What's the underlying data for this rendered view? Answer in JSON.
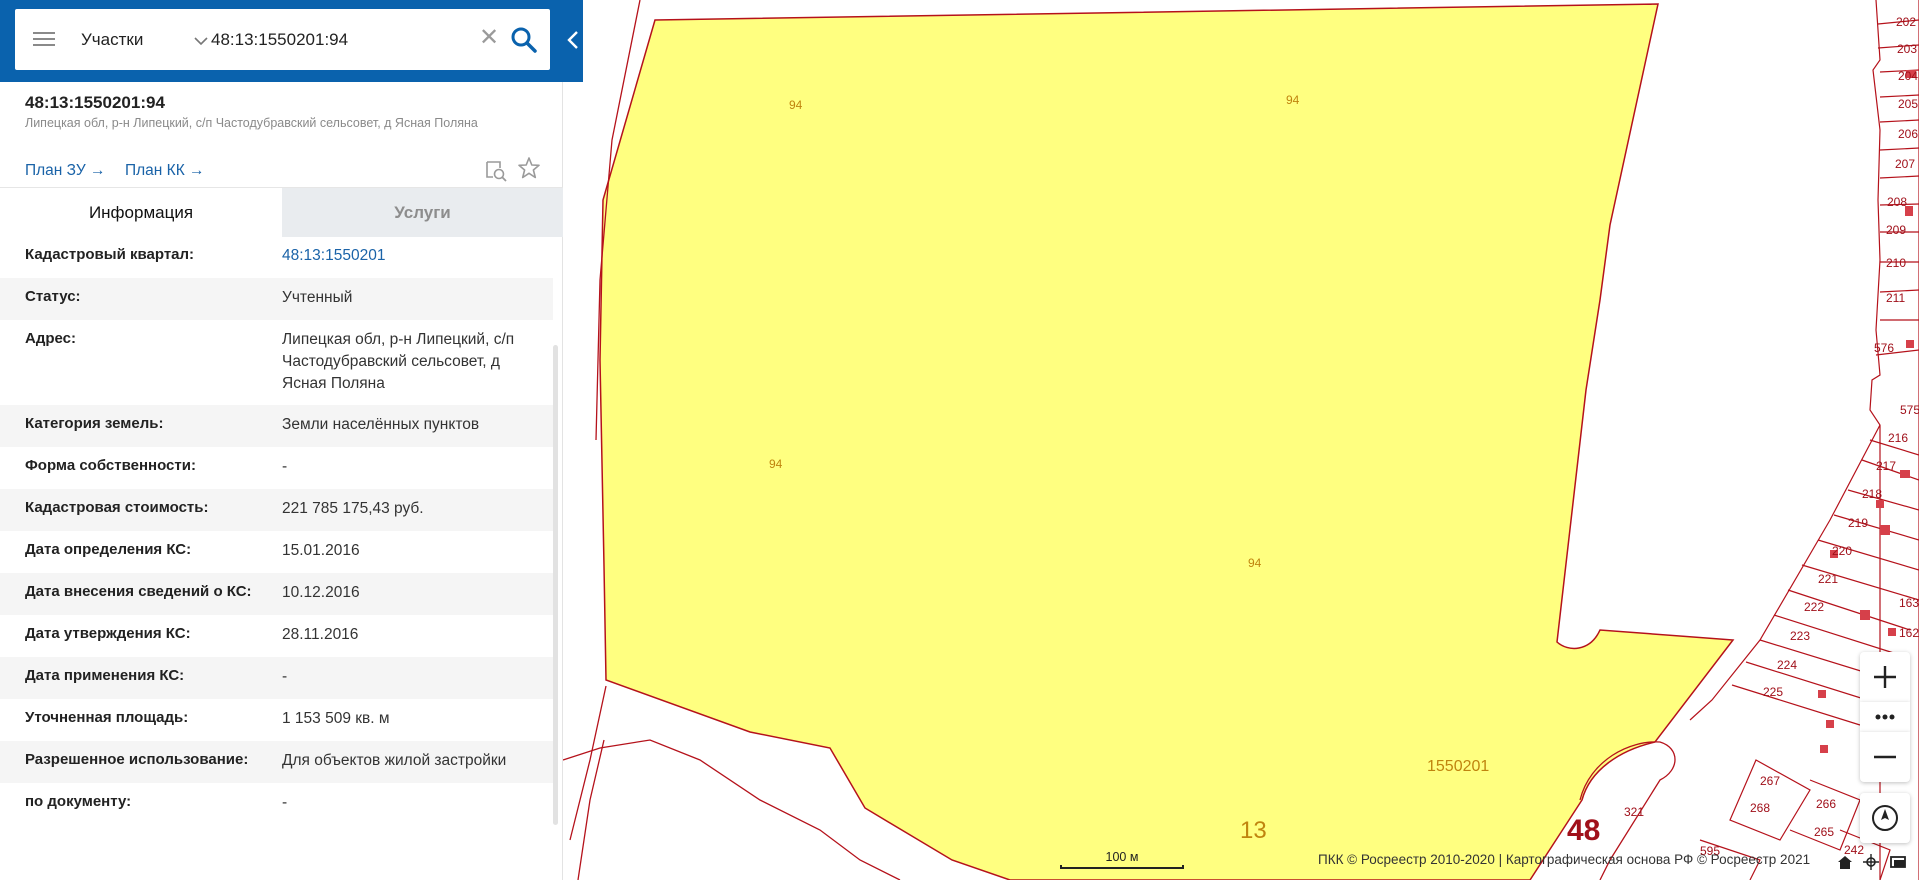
{
  "search": {
    "type_label": "Участки",
    "value": "48:13:1550201:94",
    "clear_glyph": "✕"
  },
  "object": {
    "cadastral_number": "48:13:1550201:94",
    "address": "Липецкая обл, р-н Липецкий, с/п Частодубравский сельсовет, д Ясная Поляна",
    "links": {
      "plan_zu": "План ЗУ",
      "plan_kk": "План КК"
    }
  },
  "tabs": {
    "info": "Информация",
    "services": "Услуги"
  },
  "info": {
    "rows": [
      {
        "label": "Кадастровый квартал:",
        "value": "48:13:1550201"
      },
      {
        "label": "Статус:",
        "value": "Учтенный"
      },
      {
        "label": "Адрес:",
        "value": "Липецкая обл, р-н Липецкий, с/п Частодубравский сельсовет, д Ясная Поляна"
      },
      {
        "label": "Категория земель:",
        "value": "Земли населённых пунктов"
      },
      {
        "label": "Форма собственности:",
        "value": "-"
      },
      {
        "label": "Кадастровая стоимость:",
        "value": "221 785 175,43 руб."
      },
      {
        "label": "Дата определения КС:",
        "value": "15.01.2016"
      },
      {
        "label": "Дата внесения сведений о КС:",
        "value": "10.12.2016"
      },
      {
        "label": "Дата утверждения КС:",
        "value": "28.11.2016"
      },
      {
        "label": "Дата применения КС:",
        "value": "-"
      },
      {
        "label": "Уточненная площадь:",
        "value": "1 153 509 кв. м"
      },
      {
        "label": "Разрешенное использование:",
        "value": "Для объектов жилой застройки"
      },
      {
        "label": "по документу:",
        "value": "-"
      }
    ]
  },
  "map": {
    "parcel_labels": [
      "94",
      "94",
      "94",
      "94"
    ],
    "quarter_label": "1550201",
    "district_label": "13",
    "region_label": "48",
    "side_labels": [
      "202",
      "203",
      "204",
      "205",
      "206",
      "207",
      "208",
      "209",
      "210",
      "211",
      "576",
      "575",
      "216",
      "217",
      "218",
      "219",
      "220",
      "221",
      "222",
      "223",
      "224",
      "225",
      "162",
      "163",
      "267",
      "268",
      "266",
      "265",
      "242",
      "321",
      "595"
    ],
    "scale_label": "100 м",
    "attribution": "ПКК © Росреестр 2010-2020 | Картографическая основа РФ © Росреестр 2021",
    "colors": {
      "parcel_fill": "#ffff80",
      "boundary": "#b5121b",
      "label": "#c0840e",
      "region_label": "#a0101a"
    }
  },
  "controls": {
    "zoom_in": "+",
    "zoom_out": "−"
  },
  "theme": {
    "header_blue": "#0a62ad",
    "link_blue": "#1a63a8"
  }
}
